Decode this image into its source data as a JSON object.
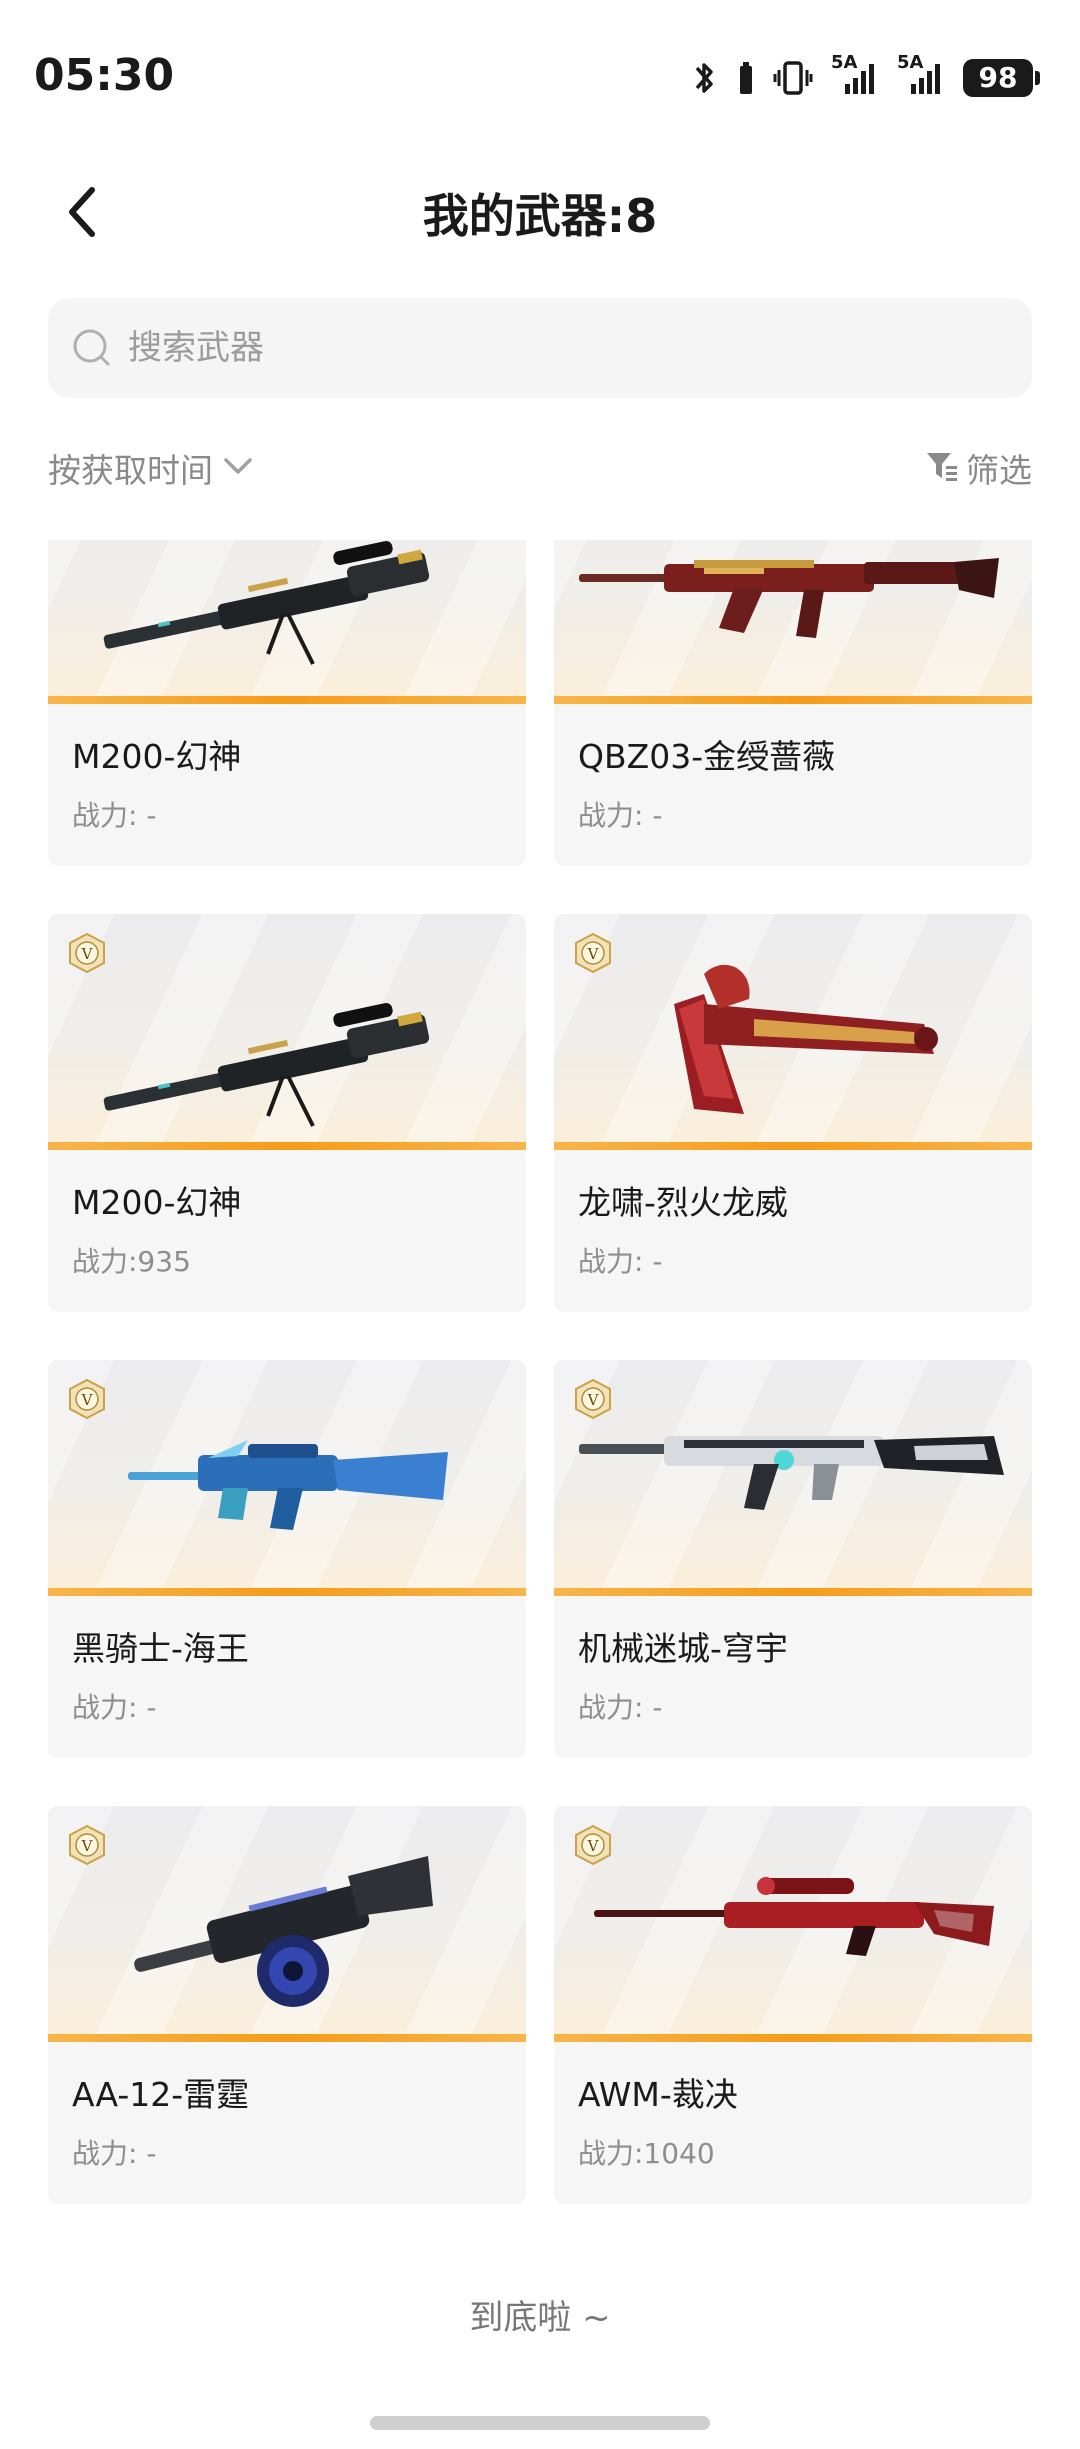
{
  "status_bar": {
    "time": "05:30",
    "signal1_label": "5A",
    "signal2_label": "5A",
    "battery": "98",
    "icons": [
      "bluetooth-icon",
      "vibrate-icon",
      "signal-icon",
      "signal-icon",
      "battery-icon"
    ]
  },
  "header": {
    "title": "我的武器:8",
    "back_icon": "chevron-left-icon"
  },
  "search": {
    "placeholder": "搜索武器",
    "value": ""
  },
  "toolbar": {
    "sort_label": "按获取时间",
    "filter_label": "筛选"
  },
  "weapons": [
    {
      "name": "M200-幻神",
      "power": "战力: -"
    },
    {
      "name": "QBZ03-金绶蔷薇",
      "power": "战力: -"
    },
    {
      "name": "M200-幻神",
      "power": "战力:935"
    },
    {
      "name": "龙啸-烈火龙威",
      "power": "战力: -"
    },
    {
      "name": "黑骑士-海王",
      "power": "战力: -"
    },
    {
      "name": "机械迷城-穹宇",
      "power": "战力: -"
    },
    {
      "name": "AA-12-雷霆",
      "power": "战力: -"
    },
    {
      "name": "AWM-裁决",
      "power": "战力:1040"
    }
  ],
  "footer": {
    "end_text": "到底啦 ~"
  },
  "colors": {
    "accent_orange": "#f59c1a",
    "badge_gold": "#c9a24a",
    "text_muted": "#8e8e8e"
  }
}
